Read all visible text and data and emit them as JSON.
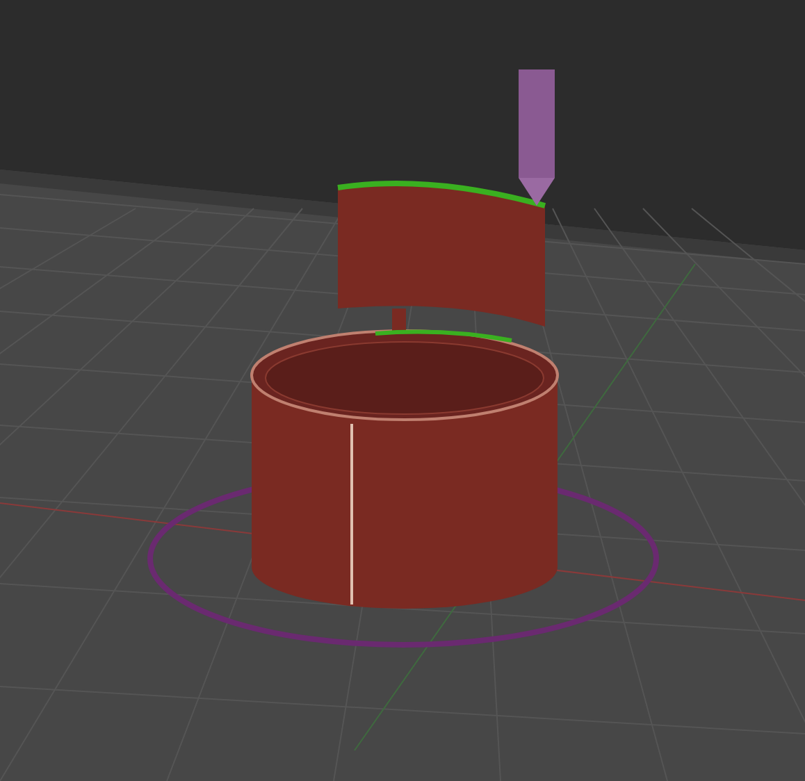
{
  "viewport": {
    "toolpaths_visible": true
  }
}
